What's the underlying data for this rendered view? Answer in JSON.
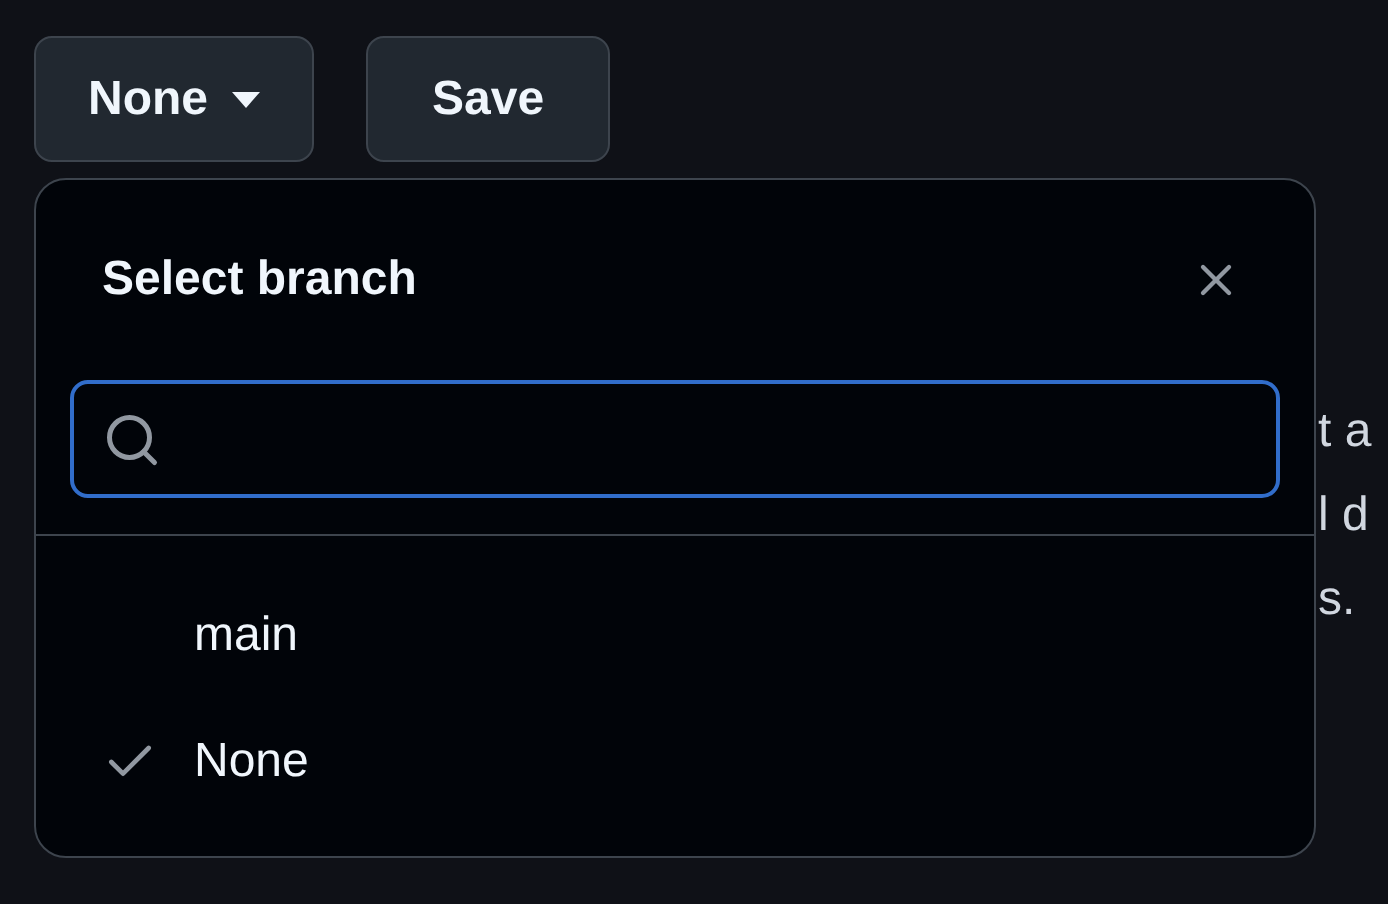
{
  "branch_button": {
    "label": "None"
  },
  "save_button": {
    "label": "Save"
  },
  "background_lines": [
    {
      "text": "t a"
    },
    {
      "text": "l d"
    },
    {
      "text": "s."
    }
  ],
  "popup": {
    "title": "Select branch",
    "items": [
      {
        "label": "main",
        "selected": false
      },
      {
        "label": "None",
        "selected": true
      }
    ]
  }
}
